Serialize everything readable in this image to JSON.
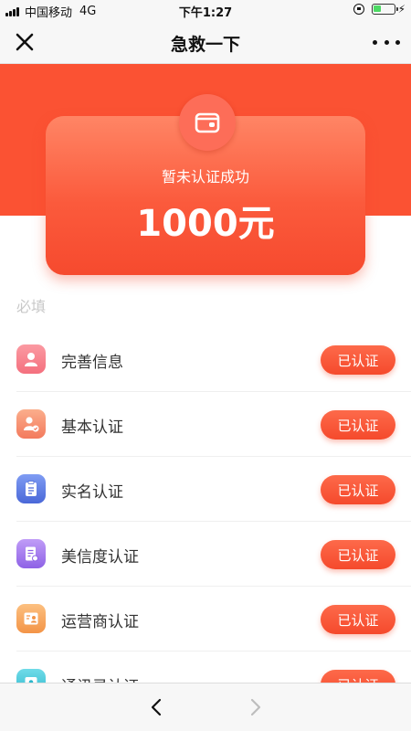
{
  "status_bar": {
    "carrier": "中国移动",
    "network": "4G",
    "time": "下午1:27"
  },
  "nav": {
    "title": "急救一下",
    "close_icon": "close-icon",
    "more_icon": "more-icon"
  },
  "hero": {
    "status": "暂未认证成功",
    "amount": "1000元",
    "icon": "wallet-icon"
  },
  "section": {
    "label": "必填"
  },
  "items": [
    {
      "label": "完善信息",
      "button": "已认证",
      "icon": "profile-icon",
      "color": "#f57a86"
    },
    {
      "label": "基本认证",
      "button": "已认证",
      "icon": "user-verified-icon",
      "color": "#f7896b"
    },
    {
      "label": "实名认证",
      "button": "已认证",
      "icon": "clipboard-icon",
      "color": "#5b7de6"
    },
    {
      "label": "美信度认证",
      "button": "已认证",
      "icon": "document-icon",
      "color": "#a57df0"
    },
    {
      "label": "运营商认证",
      "button": "已认证",
      "icon": "id-card-icon",
      "color": "#f8a85c"
    },
    {
      "label": "通讯录认证",
      "button": "已认证",
      "icon": "contacts-icon",
      "color": "#3cc6d8"
    }
  ],
  "bottom": {
    "back_icon": "back-arrow-icon",
    "forward_icon": "forward-arrow-icon"
  },
  "colors": {
    "accent": "#fb5233",
    "button": "#f54a2c",
    "hint": "#c8c8c8"
  }
}
